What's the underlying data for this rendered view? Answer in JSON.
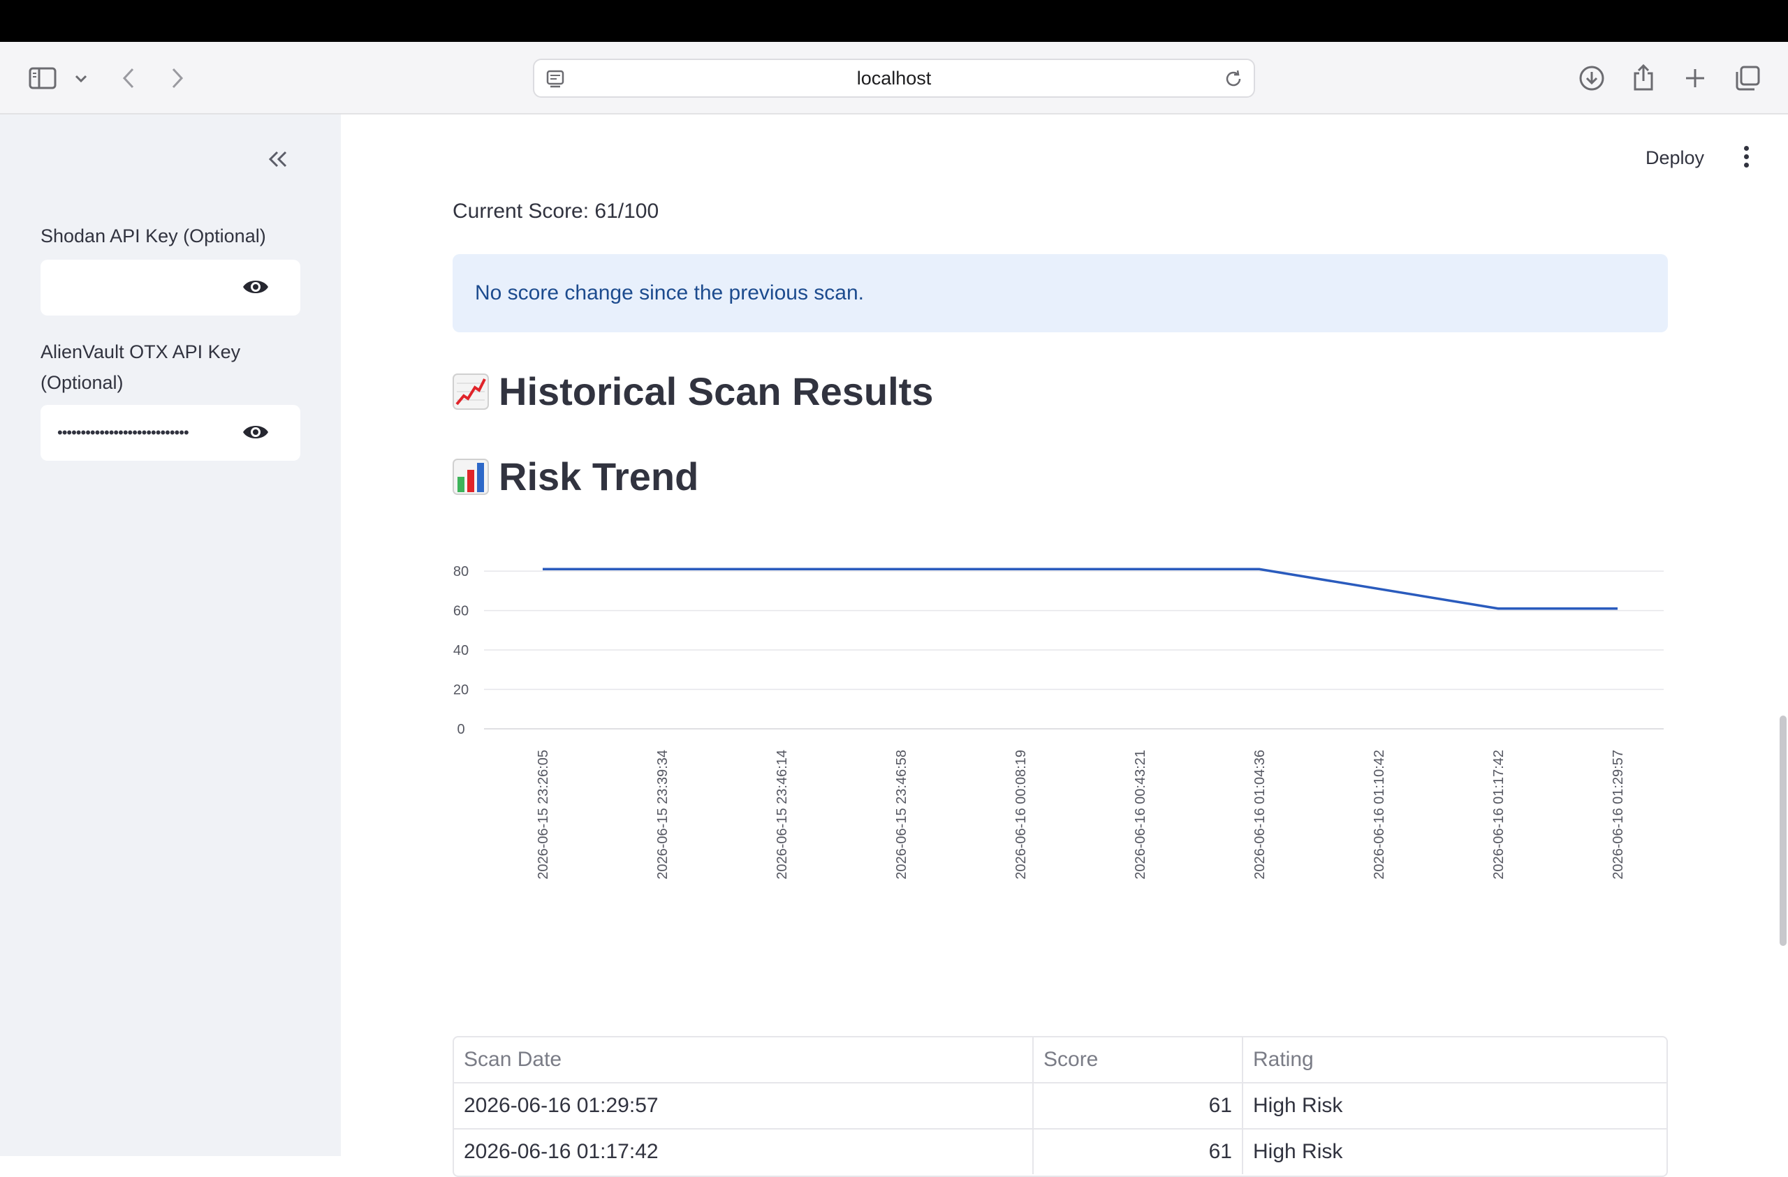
{
  "browser": {
    "url": "localhost"
  },
  "sidebar": {
    "fields": [
      {
        "label": "Shodan API Key (Optional)",
        "value": ""
      },
      {
        "label": "AlienVault OTX API Key (Optional)",
        "value": "••••••••••••••••••••••••••••"
      }
    ]
  },
  "header": {
    "deploy_label": "Deploy"
  },
  "main": {
    "current_score": "Current Score: 61/100",
    "info_message": "No score change since the previous scan.",
    "historical_heading": "Historical Scan Results",
    "risk_trend_heading": "Risk Trend"
  },
  "chart_data": {
    "type": "line",
    "x": [
      "2026-06-15 23:26:05",
      "2026-06-15 23:39:34",
      "2026-06-15 23:46:14",
      "2026-06-15 23:46:58",
      "2026-06-16 00:08:19",
      "2026-06-16 00:43:21",
      "2026-06-16 01:04:36",
      "2026-06-16 01:10:42",
      "2026-06-16 01:17:42",
      "2026-06-16 01:29:57"
    ],
    "series": [
      {
        "values": [
          81,
          81,
          81,
          81,
          81,
          81,
          81,
          null,
          61,
          61
        ]
      }
    ],
    "yticks": [
      0,
      20,
      40,
      60,
      80
    ],
    "ylim": [
      0,
      85
    ],
    "grid": true,
    "line_color": "#2a5bbd"
  },
  "table": {
    "columns": [
      "Scan Date",
      "Score",
      "Rating"
    ],
    "rows": [
      [
        "2026-06-16 01:29:57",
        "61",
        "High Risk"
      ],
      [
        "2026-06-16 01:17:42",
        "61",
        "High Risk"
      ]
    ]
  }
}
